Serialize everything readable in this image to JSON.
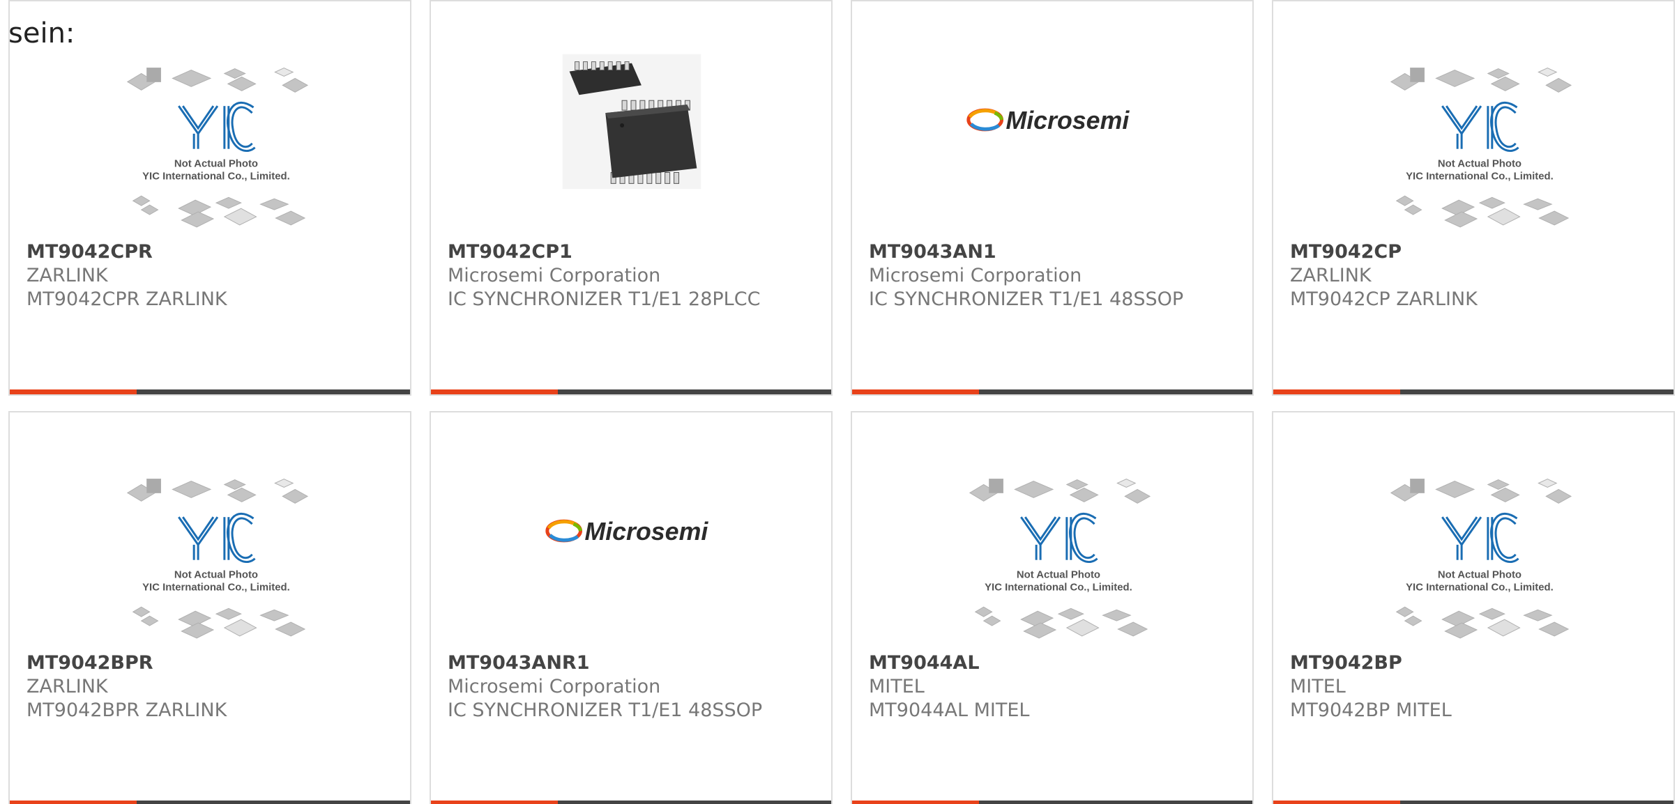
{
  "intro_text": "sein:",
  "placeholder_image": {
    "line1": "Not Actual Photo",
    "line2": "YIC International Co., Limited.",
    "logo_text": "YIC"
  },
  "brand_logo_text": "Microsemi",
  "colors": {
    "accent": "#e8421a",
    "bar": "#444444",
    "border": "#dddddd",
    "yic_blue": "#1a6db3"
  },
  "products": [
    {
      "part_number": "MT9042CPR",
      "manufacturer": "ZARLINK",
      "description": "MT9042CPR ZARLINK",
      "image": "not-actual-photo"
    },
    {
      "part_number": "MT9042CP1",
      "manufacturer": "Microsemi Corporation",
      "description": "IC SYNCHRONIZER T1/E1 28PLCC",
      "image": "plcc-chip-photo"
    },
    {
      "part_number": "MT9043AN1",
      "manufacturer": "Microsemi Corporation",
      "description": "IC SYNCHRONIZER T1/E1 48SSOP",
      "image": "microsemi-logo"
    },
    {
      "part_number": "MT9042CP",
      "manufacturer": "ZARLINK",
      "description": "MT9042CP ZARLINK",
      "image": "not-actual-photo"
    },
    {
      "part_number": "MT9042BPR",
      "manufacturer": "ZARLINK",
      "description": "MT9042BPR ZARLINK",
      "image": "not-actual-photo"
    },
    {
      "part_number": "MT9043ANR1",
      "manufacturer": "Microsemi Corporation",
      "description": "IC SYNCHRONIZER T1/E1 48SSOP",
      "image": "microsemi-logo"
    },
    {
      "part_number": "MT9044AL",
      "manufacturer": "MITEL",
      "description": "MT9044AL MITEL",
      "image": "not-actual-photo"
    },
    {
      "part_number": "MT9042BP",
      "manufacturer": "MITEL",
      "description": "MT9042BP MITEL",
      "image": "not-actual-photo"
    }
  ]
}
